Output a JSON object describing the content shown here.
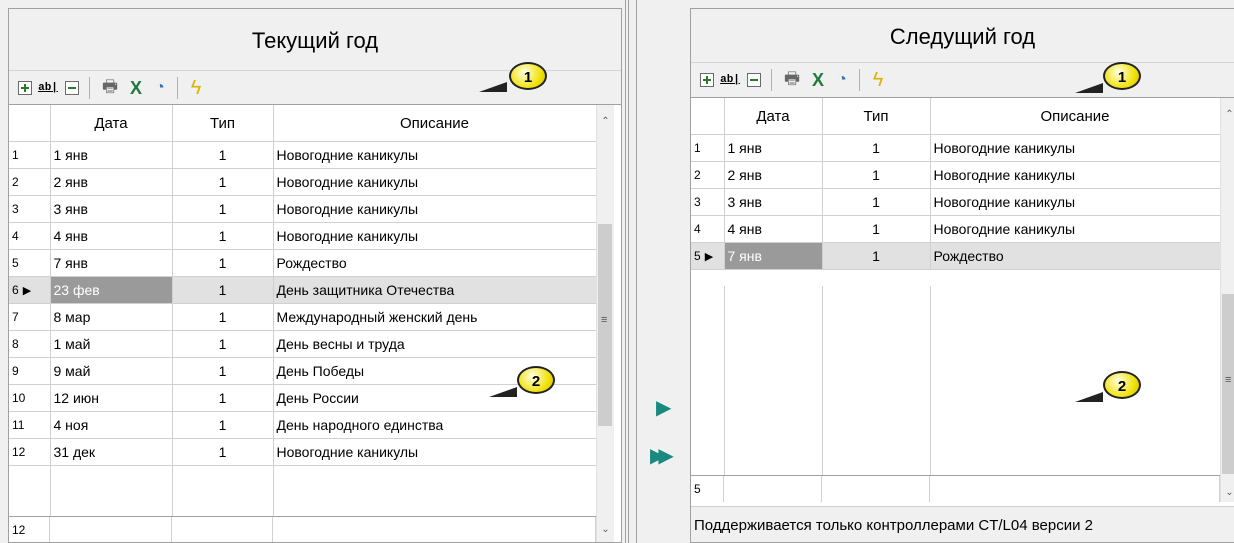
{
  "left": {
    "title": "Текущий год",
    "toolbar": {
      "add_icon": "add-row-icon",
      "edit_label": "ab|",
      "delete_icon": "delete-row-icon",
      "print_icon": "print-icon",
      "excel_icon": "excel-icon",
      "export_icon": "export-icon",
      "flash_icon": "lightning-icon"
    },
    "columns": [
      "Дата",
      "Тип",
      "Описание"
    ],
    "rows": [
      {
        "n": "1",
        "date": "1 янв",
        "type": "1",
        "desc": "Новогодние каникулы"
      },
      {
        "n": "2",
        "date": "2 янв",
        "type": "1",
        "desc": "Новогодние каникулы"
      },
      {
        "n": "3",
        "date": "3 янв",
        "type": "1",
        "desc": "Новогодние каникулы"
      },
      {
        "n": "4",
        "date": "4 янв",
        "type": "1",
        "desc": "Новогодние каникулы"
      },
      {
        "n": "5",
        "date": "7 янв",
        "type": "1",
        "desc": "Рождество"
      },
      {
        "n": "6",
        "date": "23 фев",
        "type": "1",
        "desc": "День защитника Отечества"
      },
      {
        "n": "7",
        "date": "8 мар",
        "type": "1",
        "desc": "Международный женский день"
      },
      {
        "n": "8",
        "date": "1 май",
        "type": "1",
        "desc": "День весны и труда"
      },
      {
        "n": "9",
        "date": "9 май",
        "type": "1",
        "desc": "День Победы"
      },
      {
        "n": "10",
        "date": "12 июн",
        "type": "1",
        "desc": "День России"
      },
      {
        "n": "11",
        "date": "4 ноя",
        "type": "1",
        "desc": "День народного единства"
      },
      {
        "n": "12",
        "date": "31 дек",
        "type": "1",
        "desc": "Новогодние каникулы"
      }
    ],
    "selected_row": "6",
    "footer_count": "12",
    "callouts": [
      "1",
      "2"
    ]
  },
  "right": {
    "title": "Следущий год",
    "toolbar": {
      "add_icon": "add-row-icon",
      "edit_label": "ab|",
      "delete_icon": "delete-row-icon",
      "print_icon": "print-icon",
      "excel_icon": "excel-icon",
      "export_icon": "export-icon",
      "flash_icon": "lightning-icon"
    },
    "columns": [
      "Дата",
      "Тип",
      "Описание"
    ],
    "rows": [
      {
        "n": "1",
        "date": "1 янв",
        "type": "1",
        "desc": "Новогодние каникулы"
      },
      {
        "n": "2",
        "date": "2 янв",
        "type": "1",
        "desc": "Новогодние каникулы"
      },
      {
        "n": "3",
        "date": "3 янв",
        "type": "1",
        "desc": "Новогодние каникулы"
      },
      {
        "n": "4",
        "date": "4 янв",
        "type": "1",
        "desc": "Новогодние каникулы"
      },
      {
        "n": "5",
        "date": "7 янв",
        "type": "1",
        "desc": "Рождество"
      }
    ],
    "selected_row": "5",
    "footer_count": "5",
    "callouts": [
      "1",
      "2"
    ],
    "note": "Поддерживается только контроллерами CT/L04 версии 2"
  },
  "transfer": {
    "copy_one_icon": "triangle-right-icon",
    "copy_all_icon": "double-triangle-right-icon"
  }
}
